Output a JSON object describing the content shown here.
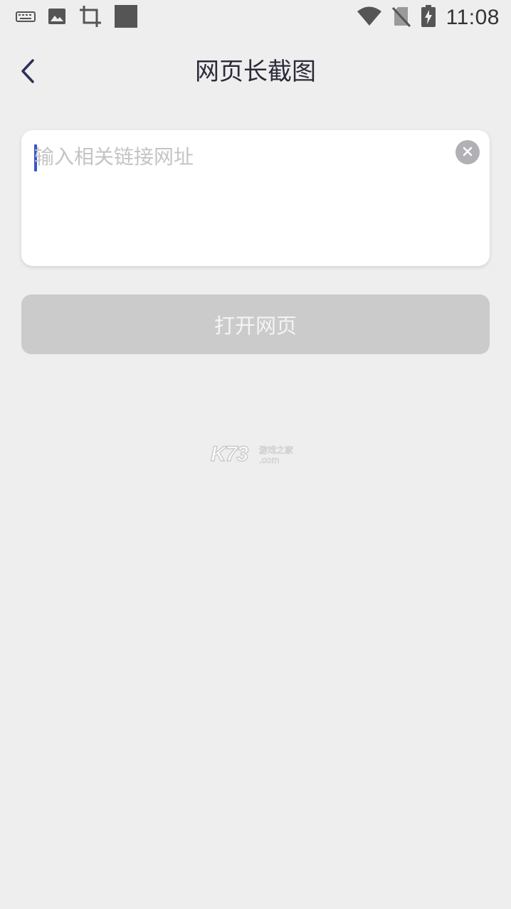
{
  "status_bar": {
    "time": "11:08",
    "left_icons": [
      "keyboard-icon",
      "image-icon",
      "crop-icon",
      "square-icon"
    ],
    "right_icons": [
      "wifi-icon",
      "no-sim-icon",
      "battery-charging-icon"
    ]
  },
  "header": {
    "back_icon": "chevron-left-icon",
    "title": "网页长截图"
  },
  "url_input": {
    "value": "",
    "placeholder": "输入相关链接网址",
    "clear_icon": "clear-icon"
  },
  "open_button": {
    "label": "打开网页"
  },
  "watermark": {
    "main": "K73",
    "sub1": "游戏之家",
    "sub2": ".com"
  },
  "colors": {
    "background": "#eeeeee",
    "card": "#ffffff",
    "button_disabled": "#cbcbcb",
    "caret": "#3a55c8",
    "title_text": "#2b2b3a"
  }
}
